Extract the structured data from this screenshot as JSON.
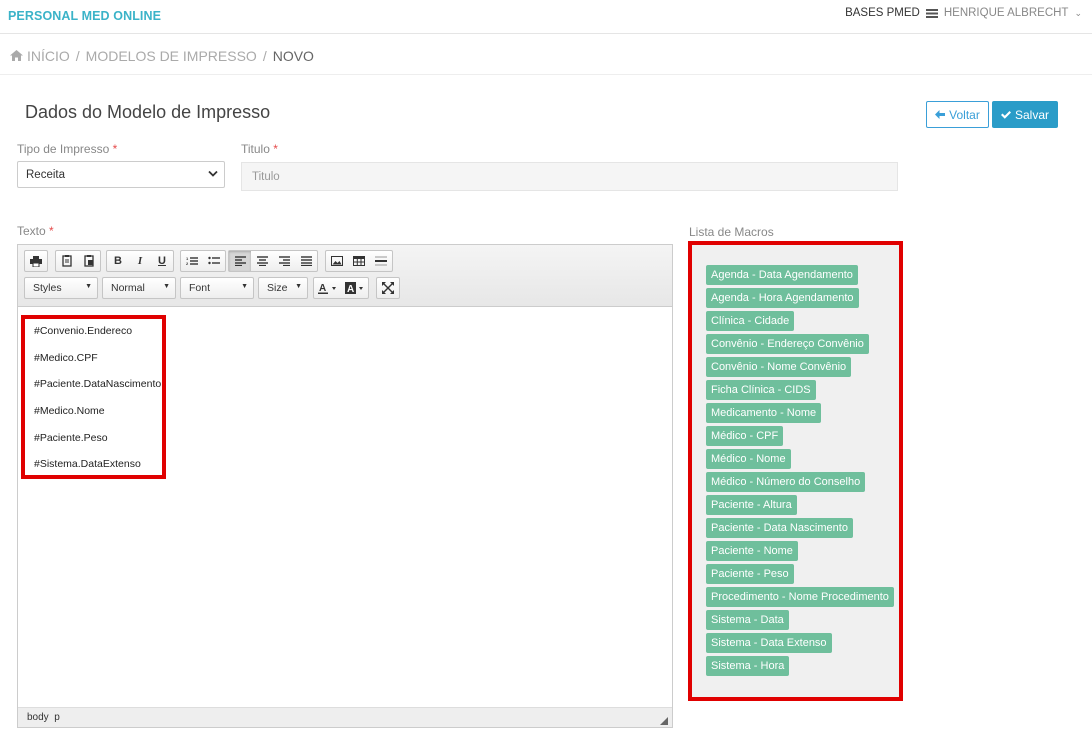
{
  "app": {
    "brand": "PERSONAL MED ONLINE",
    "bases": "BASES PMED",
    "user": "HENRIQUE ALBRECHT"
  },
  "breadcrumb": {
    "home": "INÍCIO",
    "section": "MODELOS DE IMPRESSO",
    "current": "NOVO",
    "separator": "/"
  },
  "page": {
    "title": "Dados do Modelo de Impresso"
  },
  "buttons": {
    "back": "Voltar",
    "save": "Salvar"
  },
  "form": {
    "tipo_label": "Tipo de Impresso",
    "tipo_value": "Receita",
    "titulo_label": "Titulo",
    "titulo_placeholder": "Titulo",
    "texto_label": "Texto",
    "required_mark": "*"
  },
  "toolbar": {
    "styles": "Styles",
    "format": "Normal",
    "font": "Font",
    "size": "Size",
    "bold": "B",
    "italic": "I",
    "underline": "U"
  },
  "editor": {
    "lines": [
      "#Convenio.Endereco",
      "#Medico.CPF",
      "#Paciente.DataNascimento",
      "#Medico.Nome",
      "#Paciente.Peso",
      "#Sistema.DataExtenso"
    ],
    "path_body": "body",
    "path_p": "p"
  },
  "macros": {
    "label": "Lista de Macros",
    "items": [
      "Agenda - Data Agendamento",
      "Agenda - Hora Agendamento",
      "Clínica - Cidade",
      "Convênio - Endereço Convênio",
      "Convênio - Nome Convênio",
      "Ficha Clínica - CIDS",
      "Medicamento - Nome",
      "Médico - CPF",
      "Médico - Nome",
      "Médico - Número do Conselho",
      "Paciente - Altura",
      "Paciente - Data Nascimento",
      "Paciente - Nome",
      "Paciente - Peso",
      "Procedimento - Nome Procedimento",
      "Sistema - Data",
      "Sistema - Data Extenso",
      "Sistema - Hora"
    ]
  },
  "colors": {
    "brand": "#3bb3c8",
    "accent": "#2a9cc8",
    "tag": "#6fbf9c",
    "highlight": "#e00000"
  }
}
